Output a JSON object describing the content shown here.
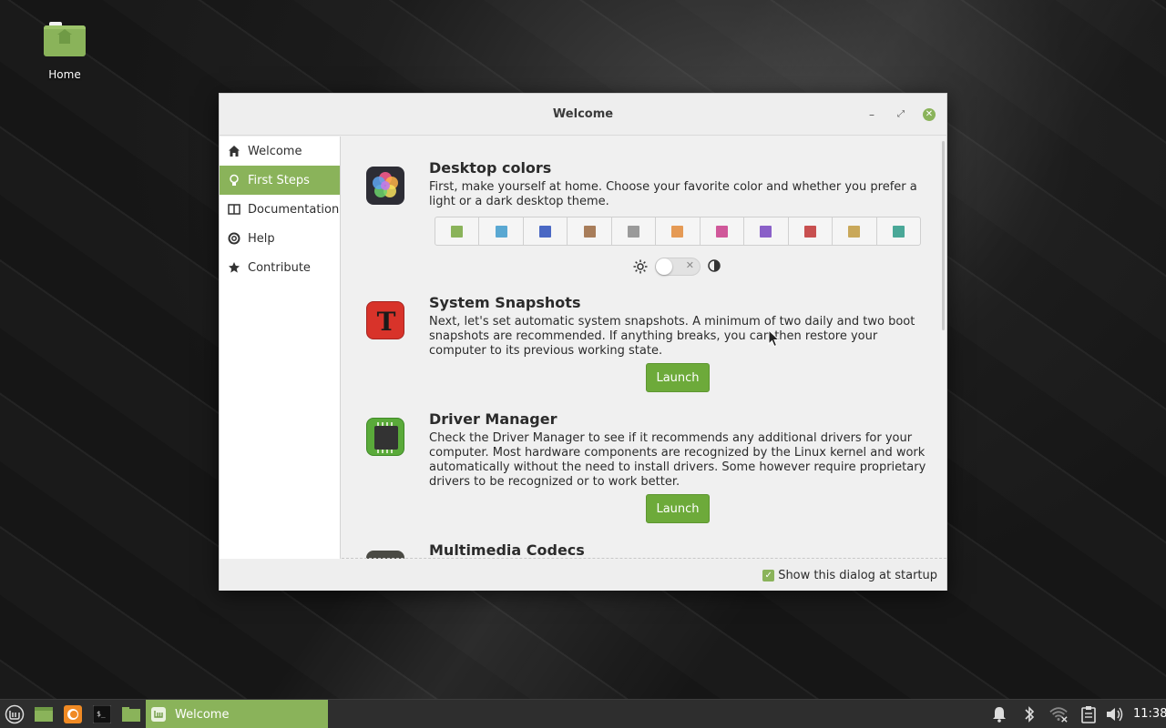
{
  "desktop": {
    "icons": [
      {
        "label": "Home",
        "icon": "home-folder-icon"
      }
    ]
  },
  "window": {
    "title": "Welcome",
    "controls": {
      "minimize": "–",
      "maximize": "⤢",
      "close": "✕"
    }
  },
  "sidebar": {
    "items": [
      {
        "label": "Welcome",
        "icon": "home-icon",
        "active": false
      },
      {
        "label": "First Steps",
        "icon": "lightbulb-icon",
        "active": true
      },
      {
        "label": "Documentation",
        "icon": "book-icon",
        "active": false
      },
      {
        "label": "Help",
        "icon": "lifebuoy-icon",
        "active": false
      },
      {
        "label": "Contribute",
        "icon": "star-icon",
        "active": false
      }
    ]
  },
  "sections": [
    {
      "title": "Desktop colors",
      "desc": "First, make yourself at home. Choose your favorite color and whether you prefer a light or a dark desktop theme.",
      "icon": "color-flower-icon"
    },
    {
      "title": "System Snapshots",
      "desc": "Next, let's set automatic system snapshots. A minimum of two daily and two boot snapshots are recommended. If anything breaks, you can then restore your computer to its previous working state.",
      "icon": "timeshift-icon",
      "button": "Launch"
    },
    {
      "title": "Driver Manager",
      "desc": "Check the Driver Manager to see if it recommends any additional drivers for your computer. Most hardware components are recognized by the Linux kernel and work automatically without the need to install drivers. Some however require proprietary drivers to be recognized or to work better.",
      "icon": "chip-icon",
      "button": "Launch"
    },
    {
      "title": "Multimedia Codecs",
      "icon": "codecs-icon"
    }
  ],
  "color_swatches": [
    "#8ab35a",
    "#5aa8d2",
    "#4a68c4",
    "#a87d5a",
    "#9a9a9a",
    "#e59a55",
    "#d0589a",
    "#8a60c8",
    "#c85050",
    "#c9a85a",
    "#4aa898"
  ],
  "theme_toggle": {
    "light_icon": "sun-icon",
    "dark_icon": "moon-icon",
    "dark_enabled": false,
    "knob_mark": "✕"
  },
  "footer": {
    "startup_label": "Show this dialog at startup",
    "checked": true
  },
  "taskbar": {
    "launchers": [
      "mint-menu-icon",
      "show-desktop-icon",
      "firefox-icon",
      "terminal-icon",
      "files-icon"
    ],
    "task_label": "Welcome",
    "tray": [
      "bell-icon",
      "bluetooth-icon",
      "wifi-icon",
      "clipboard-icon",
      "volume-icon"
    ],
    "clock": "11:38"
  },
  "colors": {
    "accent": "#8ab35a",
    "button": "#6daa3a"
  }
}
